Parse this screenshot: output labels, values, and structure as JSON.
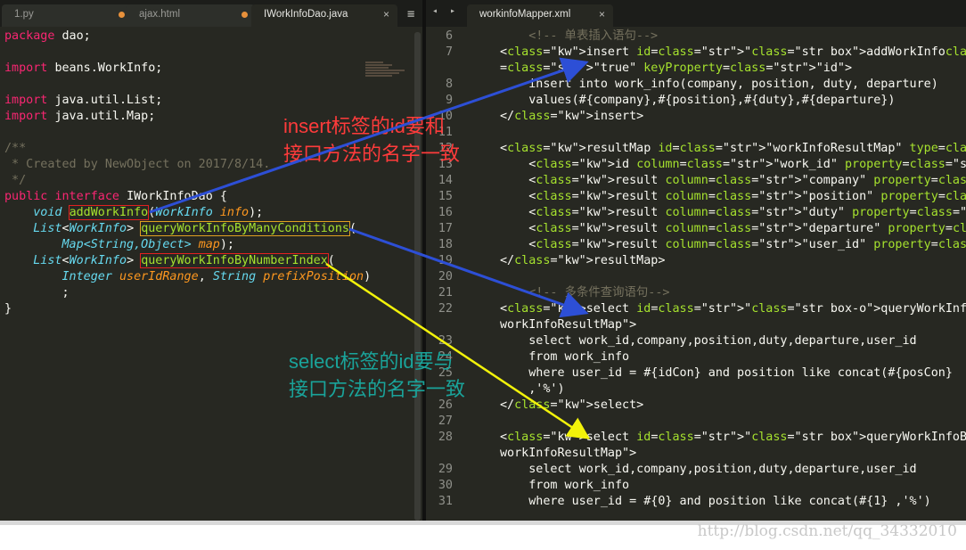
{
  "left_tabs": [
    {
      "label": "1.py",
      "modified": true
    },
    {
      "label": "ajax.html",
      "modified": true
    },
    {
      "label": "IWorkInfoDao.java",
      "active": true,
      "close": "×"
    }
  ],
  "right_tabs": [
    {
      "label": "workinfoMapper.xml",
      "active": true,
      "close": "×"
    }
  ],
  "menu_glyph": "≡",
  "nav_glyph": "◂ ▸",
  "java": {
    "package_kw": "package",
    "package_name": "dao;",
    "import_kw": "import",
    "imports": [
      "beans.WorkInfo;",
      "java.util.List;",
      "java.util.Map;"
    ],
    "doc_open": "/**",
    "doc_line": " * Created by NewObject on 2017/8/14.",
    "doc_close": " */",
    "public_kw": "public",
    "interface_kw": "interface",
    "interface_name": "IWorkInfoDao",
    "brace_open": "{",
    "void_kw": "void",
    "m1_name": "addWorkInfo",
    "m1_type": "WorkInfo",
    "m1_param": "info",
    "list_type": "List",
    "generic_type": "WorkInfo",
    "m2_name": "queryWorkInfoByManyConditions",
    "map_type": "Map",
    "map_generics": "String,Object",
    "map_param": "map",
    "m3_name": "queryWorkInfoByNumberIndex",
    "int_type": "Integer",
    "p1": "userIdRange",
    "str_type": "String",
    "p2": "prefixPosition",
    "semicolon": ";",
    "brace_close": "}"
  },
  "xml_lines": [
    {
      "n": "6",
      "text": "    <!-- 单表插入语句-->"
    },
    {
      "n": "7",
      "text": "<insert id=\"addWorkInfo\" parameterType=\"WorkInfo\" useGeneratedKeys"
    },
    {
      "n": "",
      "text": "=\"true\" keyProperty=\"id\">"
    },
    {
      "n": "8",
      "text": "    insert into work_info(company, position, duty, departure)"
    },
    {
      "n": "9",
      "text": "    values(#{company},#{position},#{duty},#{departure})"
    },
    {
      "n": "10",
      "text": "</insert>"
    },
    {
      "n": "11",
      "text": ""
    },
    {
      "n": "12",
      "text": "<resultMap id=\"workInfoResultMap\" type=\"WorkInfo\">"
    },
    {
      "n": "13",
      "text": "    <id column=\"work_id\" property=\"work_id\"/>"
    },
    {
      "n": "14",
      "text": "    <result column=\"company\" property=\"company\"/>"
    },
    {
      "n": "15",
      "text": "    <result column=\"position\" property=\"position\"/>"
    },
    {
      "n": "16",
      "text": "    <result column=\"duty\" property=\"duty\"/>"
    },
    {
      "n": "17",
      "text": "    <result column=\"departure\" property=\"departure\"/>"
    },
    {
      "n": "18",
      "text": "    <result column=\"user_id\" property=\"user_id\"/>"
    },
    {
      "n": "19",
      "text": "</resultMap>"
    },
    {
      "n": "20",
      "text": ""
    },
    {
      "n": "21",
      "text": "    <!-- 多条件查询语句-->"
    },
    {
      "n": "22",
      "text": "<select id=\"queryWorkInfoByManyConditions\" resultMap=\""
    },
    {
      "n": "",
      "text": "workInfoResultMap\">"
    },
    {
      "n": "23",
      "text": "    select work_id,company,position,duty,departure,user_id"
    },
    {
      "n": "24",
      "text": "    from work_info"
    },
    {
      "n": "25",
      "text": "    where user_id = #{idCon} and position like concat(#{posCon}"
    },
    {
      "n": "",
      "text": "    ,'%')"
    },
    {
      "n": "26",
      "text": "</select>"
    },
    {
      "n": "27",
      "text": ""
    },
    {
      "n": "28",
      "text": "<select id=\"queryWorkInfoByNumberIndex\" resultMap=\""
    },
    {
      "n": "",
      "text": "workInfoResultMap\">"
    },
    {
      "n": "29",
      "text": "    select work_id,company,position,duty,departure,user_id"
    },
    {
      "n": "30",
      "text": "    from work_info"
    },
    {
      "n": "31",
      "text": "    where user_id = #{0} and position like concat(#{1} ,'%')"
    }
  ],
  "annotations": {
    "red_line1": "insert标签的id要和",
    "red_line2": "接口方法的名字一致",
    "teal_line1": "select标签的id要与",
    "teal_line2": "接口方法的名字一致"
  },
  "colors": {
    "editor_bg": "#272822",
    "red_box": "#e32020",
    "blue_arrow": "#2d4fd6",
    "yellow_arrow": "#f2f20a"
  },
  "watermark": "http://blog.csdn.net/qq_34332010"
}
